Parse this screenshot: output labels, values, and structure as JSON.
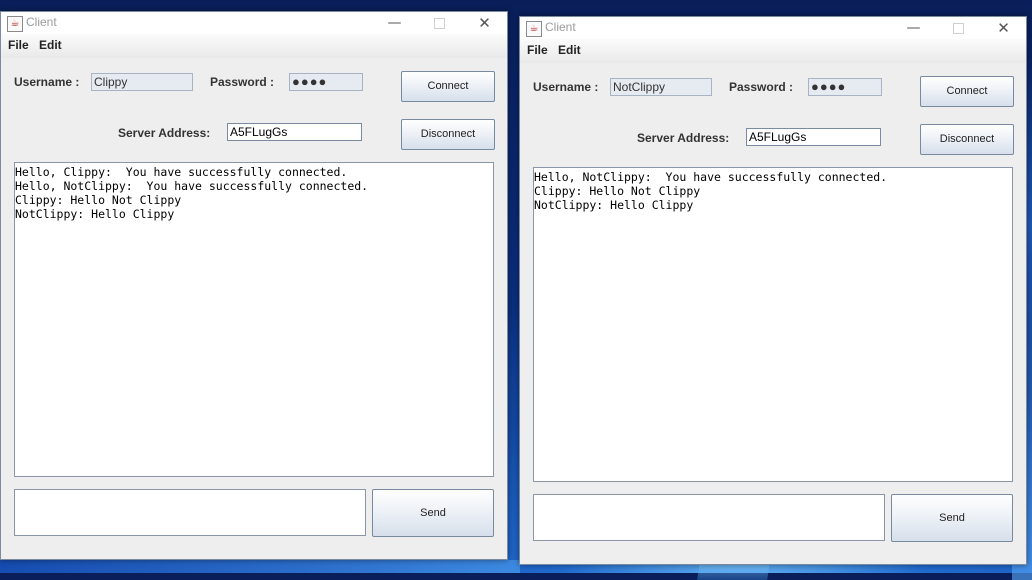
{
  "windows": [
    {
      "title": "Client",
      "controls": {
        "minimize": "—",
        "close": "✕"
      },
      "menu": [
        "File",
        "Edit"
      ],
      "username_label": "Username :",
      "username_value": "Clippy",
      "password_label": "Password :",
      "password_value": "●●●●",
      "server_label": "Server Address:",
      "server_value": "A5FLugGs",
      "connect_label": "Connect",
      "disconnect_label": "Disconnect",
      "send_label": "Send",
      "message_value": "",
      "chat": [
        "Hello, Clippy:  You have successfully connected.",
        "Hello, NotClippy:  You have successfully connected.",
        "Clippy: Hello Not Clippy",
        "NotClippy: Hello Clippy"
      ]
    },
    {
      "title": "Client",
      "controls": {
        "minimize": "—",
        "close": "✕"
      },
      "menu": [
        "File",
        "Edit"
      ],
      "username_label": "Username :",
      "username_value": "NotClippy",
      "password_label": "Password :",
      "password_value": "●●●●",
      "server_label": "Server Address:",
      "server_value": "A5FLugGs",
      "connect_label": "Connect",
      "disconnect_label": "Disconnect",
      "send_label": "Send",
      "message_value": "",
      "chat": [
        "Hello, NotClippy:  You have successfully connected.",
        "Clippy: Hello Not Clippy",
        "NotClippy: Hello Clippy"
      ]
    }
  ],
  "icons": {
    "app": "java-cup-icon",
    "min": "minimize-icon",
    "max": "maximize-icon",
    "close": "close-icon"
  }
}
